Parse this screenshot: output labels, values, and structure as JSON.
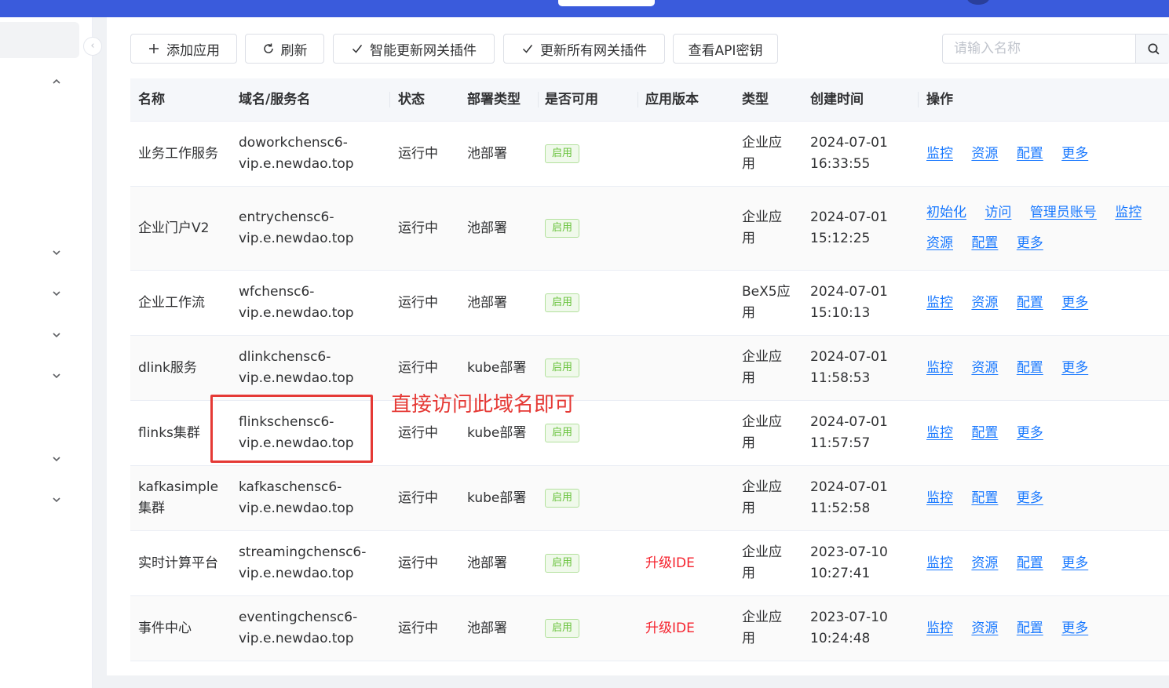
{
  "toolbar": {
    "add_app": "添加应用",
    "refresh": "刷新",
    "smart_update_plugins": "智能更新网关插件",
    "update_all_plugins": "更新所有网关插件",
    "view_api_key": "查看API密钥"
  },
  "search": {
    "placeholder": "请输入名称"
  },
  "table": {
    "headers": [
      "名称",
      "域名/服务名",
      "状态",
      "部署类型",
      "是否可用",
      "应用版本",
      "类型",
      "创建时间",
      "操作"
    ],
    "rows": [
      {
        "name": "业务工作服务",
        "domain_l1": "doworkchensc6-",
        "domain_l2": "vip.e.newdao.top",
        "status": "运行中",
        "deploy": "池部署",
        "available": "启用",
        "version": "",
        "type_l1": "企业应",
        "type_l2": "用",
        "date": "2024-07-01",
        "time": "16:33:55",
        "ops": [
          "监控",
          "资源",
          "配置",
          "更多"
        ]
      },
      {
        "name": "企业门户V2",
        "domain_l1": "entrychensc6-",
        "domain_l2": "vip.e.newdao.top",
        "status": "运行中",
        "deploy": "池部署",
        "available": "启用",
        "version": "",
        "type_l1": "企业应",
        "type_l2": "用",
        "date": "2024-07-01",
        "time": "15:12:25",
        "ops": [
          "初始化",
          "访问",
          "管理员账号",
          "监控",
          "资源",
          "配置",
          "更多"
        ]
      },
      {
        "name": "企业工作流",
        "domain_l1": "wfchensc6-",
        "domain_l2": "vip.e.newdao.top",
        "status": "运行中",
        "deploy": "池部署",
        "available": "启用",
        "version": "",
        "type_l1": "BeX5应",
        "type_l2": "用",
        "date": "2024-07-01",
        "time": "15:10:13",
        "ops": [
          "监控",
          "资源",
          "配置",
          "更多"
        ]
      },
      {
        "name": "dlink服务",
        "domain_l1": "dlinkchensc6-",
        "domain_l2": "vip.e.newdao.top",
        "status": "运行中",
        "deploy": "kube部署",
        "available": "启用",
        "version": "",
        "type_l1": "企业应",
        "type_l2": "用",
        "date": "2024-07-01",
        "time": "11:58:53",
        "ops": [
          "监控",
          "资源",
          "配置",
          "更多"
        ]
      },
      {
        "name": "flinks集群",
        "domain_l1": "flinkschensc6-",
        "domain_l2": "vip.e.newdao.top",
        "status": "运行中",
        "deploy": "kube部署",
        "available": "启用",
        "version": "",
        "type_l1": "企业应",
        "type_l2": "用",
        "date": "2024-07-01",
        "time": "11:57:57",
        "ops": [
          "监控",
          "配置",
          "更多"
        ]
      },
      {
        "name": "kafkasimple集群",
        "domain_l1": "kafkaschensc6-",
        "domain_l2": "vip.e.newdao.top",
        "status": "运行中",
        "deploy": "kube部署",
        "available": "启用",
        "version": "",
        "type_l1": "企业应",
        "type_l2": "用",
        "date": "2024-07-01",
        "time": "11:52:58",
        "ops": [
          "监控",
          "配置",
          "更多"
        ]
      },
      {
        "name": "实时计算平台",
        "domain_l1": "streamingchensc6-",
        "domain_l2": "vip.e.newdao.top",
        "status": "运行中",
        "deploy": "池部署",
        "available": "启用",
        "version": "升级IDE",
        "type_l1": "企业应",
        "type_l2": "用",
        "date": "2023-07-10",
        "time": "10:27:41",
        "ops": [
          "监控",
          "资源",
          "配置",
          "更多"
        ]
      },
      {
        "name": "事件中心",
        "domain_l1": "eventingchensc6-",
        "domain_l2": "vip.e.newdao.top",
        "status": "运行中",
        "deploy": "池部署",
        "available": "启用",
        "version": "升级IDE",
        "type_l1": "企业应",
        "type_l2": "用",
        "date": "2023-07-10",
        "time": "10:24:48",
        "ops": [
          "监控",
          "资源",
          "配置",
          "更多"
        ]
      }
    ]
  },
  "annotation": {
    "text": "直接访问此域名即可"
  },
  "colors": {
    "topbar": "#3a5bdc",
    "link": "#1677ff",
    "badge_green": "#67c23a",
    "warning_red": "#f5222d",
    "annotation_red": "#e53935"
  },
  "icons": {
    "add": "plus-icon",
    "refresh": "refresh-icon",
    "check": "check-icon",
    "search": "search-icon",
    "collapse": "chevron-left-icon",
    "expand": "chevron-down-icon"
  }
}
